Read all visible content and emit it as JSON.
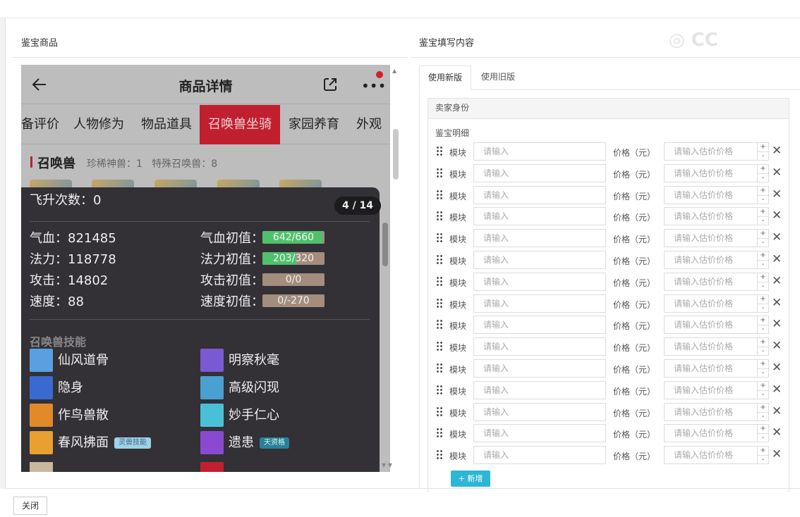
{
  "left_panel": {
    "title": "鉴宝商品"
  },
  "phone": {
    "header_title": "商品详情",
    "tabs": [
      "备评价",
      "人物修为",
      "物品道具",
      "召唤兽坐骑",
      "家园养育",
      "外观"
    ],
    "active_tab": "召唤兽坐骑",
    "section_title": "召唤兽",
    "section_sub": "珍稀神兽：1   特殊召唤兽：8",
    "popup": {
      "ascension": "飞升次数：0",
      "pager": "4 / 14",
      "stats": [
        {
          "label": "气血：821485",
          "init_label": "气血初值：",
          "init_value": "642/660",
          "fill": 0.97
        },
        {
          "label": "法力：118778",
          "init_label": "法力初值：",
          "init_value": "203/320",
          "fill": 0.55
        },
        {
          "label": "攻击：14802",
          "init_label": "攻击初值：",
          "init_value": "0/0",
          "fill": 0
        },
        {
          "label": "速度：88",
          "init_label": "速度初值：",
          "init_value": "0/-270",
          "fill": 0
        }
      ],
      "skills_title": "召唤兽技能",
      "skills": [
        {
          "name": "仙风道骨",
          "color": "#5aa0e0"
        },
        {
          "name": "明察秋毫",
          "color": "#7a5ad0"
        },
        {
          "name": "隐身",
          "color": "#3a6ad0"
        },
        {
          "name": "高级闪现",
          "color": "#4aa0d0"
        },
        {
          "name": "作鸟兽散",
          "color": "#e08a2a"
        },
        {
          "name": "妙手仁心",
          "color": "#4ac0d8"
        },
        {
          "name": "春风拂面",
          "color": "#e8a030",
          "tag": "灵兽技能"
        },
        {
          "name": "遗患",
          "color": "#8a4ad0",
          "tag": "天资格"
        }
      ]
    }
  },
  "right_panel": {
    "title": "鉴宝填写内容",
    "tabs": [
      "使用新版",
      "使用旧版"
    ],
    "seller_label": "卖家身份",
    "detail_label": "鉴宝明细",
    "row": {
      "module_label": "模块",
      "module_placeholder": "请输入",
      "price_label": "价格（元）",
      "price_placeholder": "请输入估价价格",
      "plus": "+",
      "minus": "-",
      "remove": "✕"
    },
    "row_count": 15,
    "add_button": "+ 新增"
  },
  "footer": {
    "close_button": "关闭"
  }
}
